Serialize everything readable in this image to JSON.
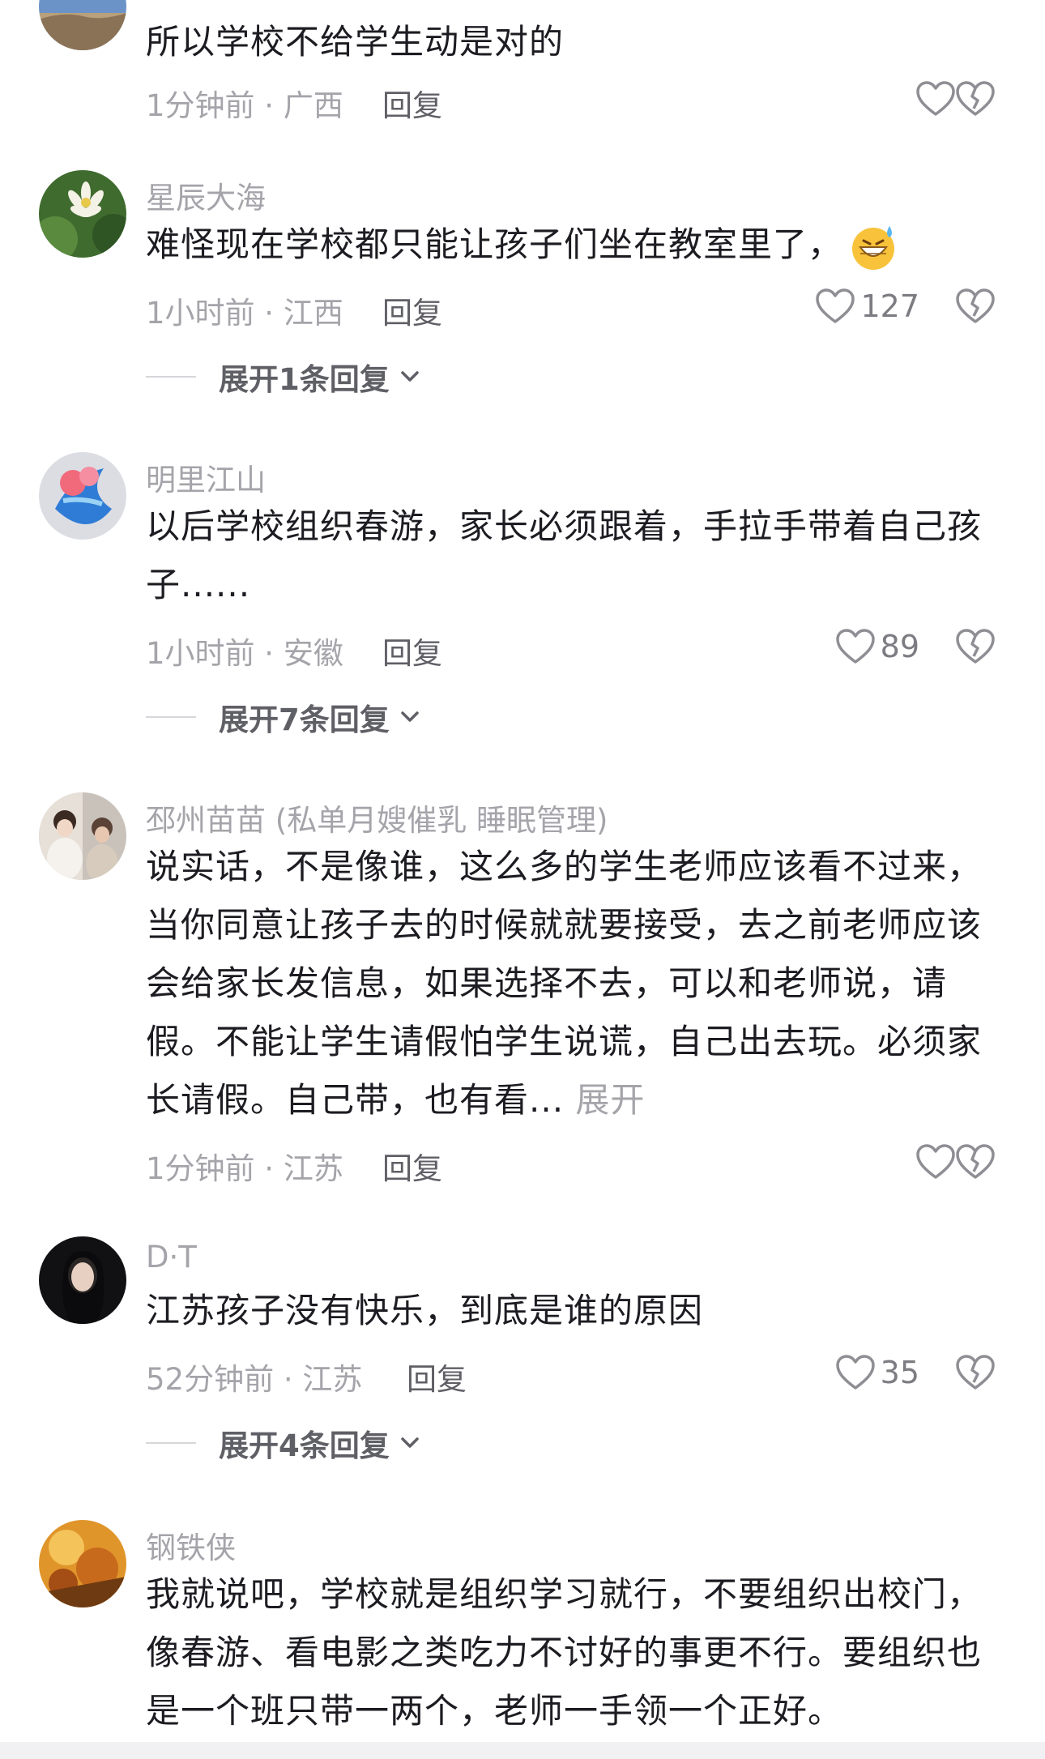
{
  "comments": [
    {
      "username": "",
      "text": "所以学校不给学生动是对的",
      "time": "1分钟前",
      "location": "广西",
      "reply_label": "回复",
      "likes": ""
    },
    {
      "username": "星辰大海",
      "text": "难怪现在学校都只能让孩子们坐在教室里了，",
      "emoji": "grinning-sweat-emoji",
      "time": "1小时前",
      "location": "江西",
      "reply_label": "回复",
      "likes": "127",
      "expand_label": "展开1条回复"
    },
    {
      "username": "明里江山",
      "text": "以后学校组织春游，家长必须跟着，手拉手带着自己孩子......",
      "time": "1小时前",
      "location": "安徽",
      "reply_label": "回复",
      "likes": "89",
      "expand_label": "展开7条回复"
    },
    {
      "username": "邳州苗苗 (私单月嫂催乳 睡眠管理)",
      "text": "说实话，不是像谁，这么多的学生老师应该看不过来，当你同意让孩子去的时候就就要接受，去之前老师应该会给家长发信息，如果选择不去，可以和老师说，请假。不能让学生请假怕学生说谎，自己出去玩。必须家长请假。自己带，也有看...",
      "more_label": "展开",
      "time": "1分钟前",
      "location": "江苏",
      "reply_label": "回复",
      "likes": ""
    },
    {
      "username": "D·T",
      "text": "江苏孩子没有快乐，到底是谁的原因",
      "time": "52分钟前",
      "location": "江苏",
      "reply_label": "回复",
      "likes": "35",
      "expand_label": "展开4条回复"
    },
    {
      "username": "钢铁侠",
      "text": "我就说吧，学校就是组织学习就行，不要组织出校门，像春游、看电影之类吃力不讨好的事更不行。要组织也是一个班只带一两个，老师一手领一个正好。"
    }
  ],
  "meta_separator": " · ",
  "icons": {
    "like": "heart-outline-icon",
    "dislike": "broken-heart-icon",
    "expand": "chevron-down-icon"
  },
  "colors": {
    "secondary_text": "#a4a4aa",
    "primary_text": "#1c1c22",
    "reply_text": "#5f5f66"
  }
}
